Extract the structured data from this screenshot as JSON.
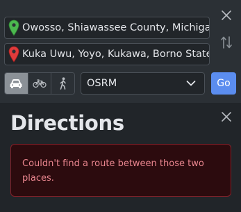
{
  "route": {
    "from_value": "Owosso, Shiawassee County, Michigan",
    "to_value": "Kuka Uwu, Yoyo, Kukawa, Borno State",
    "modes": [
      {
        "name": "car",
        "icon": "car-icon",
        "active": true
      },
      {
        "name": "bicycle",
        "icon": "bicycle-icon",
        "active": false
      },
      {
        "name": "foot",
        "icon": "walking-person-icon",
        "active": false
      }
    ],
    "engine_selected": "OSRM",
    "go_label": "Go"
  },
  "directions": {
    "title": "Directions",
    "error_message": "Couldn't find a route between those two places."
  },
  "colors": {
    "from_pin": "#4cb84f",
    "to_pin": "#e03b3b",
    "go_button": "#5b8def",
    "alert_background": "#2c0b0e",
    "alert_border": "#842029",
    "alert_text": "#ea868f"
  }
}
